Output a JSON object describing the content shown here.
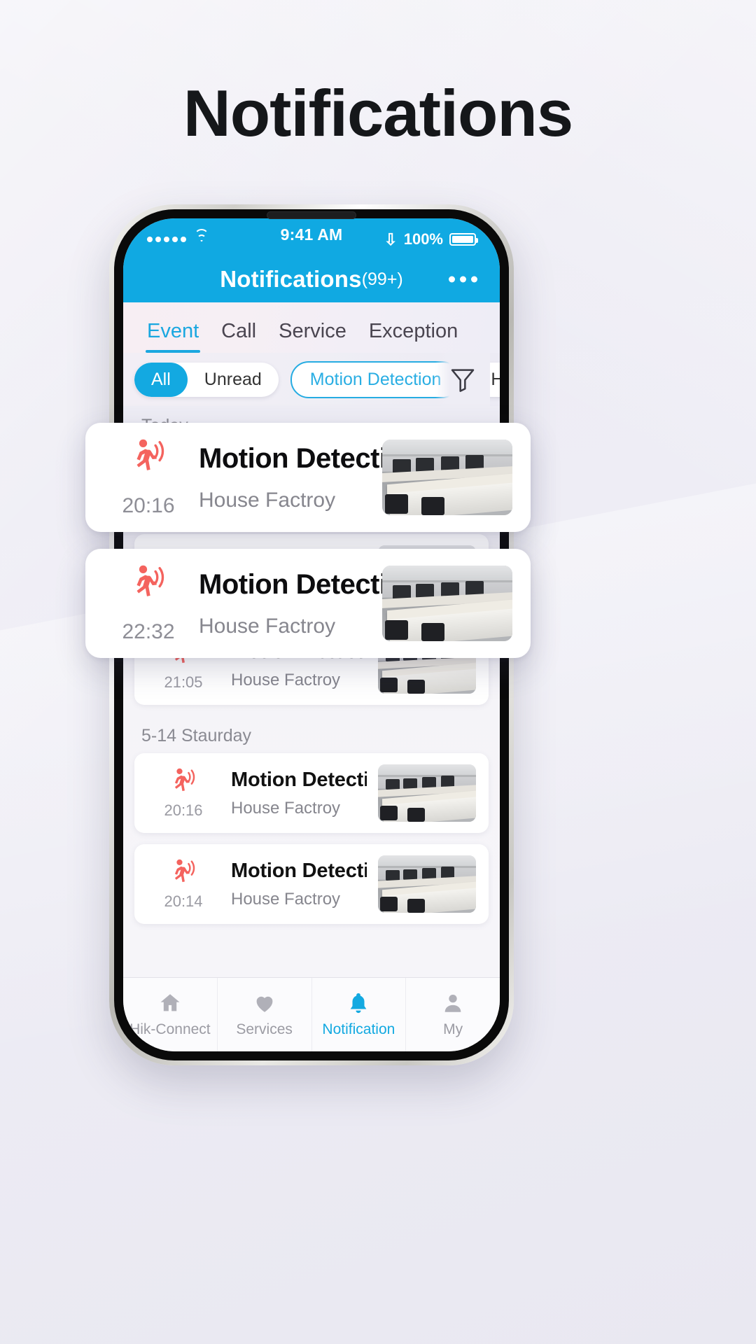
{
  "page": {
    "heading": "Notifications",
    "accent": "#13a9e1",
    "alert_red": "#f4635e",
    "bg": "#edecf4"
  },
  "status_bar": {
    "signal_icon": "signal-dots-icon",
    "wifi_icon": "wifi-icon",
    "time": "9:41 AM",
    "bluetooth_icon": "bluetooth-icon",
    "battery_percent": "100%",
    "battery_icon": "battery-full-icon"
  },
  "nav_bar": {
    "title": "Notifications",
    "count": "(99+)",
    "more_icon": "more-horizontal-icon"
  },
  "tabs": [
    {
      "label": "Event",
      "active": true
    },
    {
      "label": "Call",
      "active": false
    },
    {
      "label": "Service",
      "active": false
    },
    {
      "label": "Exception",
      "active": false
    }
  ],
  "filters": {
    "segmented": [
      {
        "label": "All",
        "selected": true
      },
      {
        "label": "Unread",
        "selected": false
      }
    ],
    "chips": [
      {
        "label": "Motion Detection",
        "selected": true
      },
      {
        "label": "Human Dete",
        "selected": false
      }
    ],
    "filter_icon": "funnel-filter-icon"
  },
  "sections": [
    {
      "label": "Today",
      "items": [
        {
          "time": "20:16",
          "title": "Motion Detection...",
          "device": "House Factroy",
          "unread": true,
          "icon": "motion-detection-icon",
          "thumbnail": "office-desks-thumbnail"
        },
        {
          "time": "22:32",
          "title": "Motion Detection...",
          "device": "House Factroy",
          "unread": false,
          "icon": "motion-detection-icon",
          "thumbnail": "office-desks-thumbnail"
        },
        {
          "time": "21:05",
          "title": "Motion Detection...",
          "device": "House Factroy",
          "unread": false,
          "icon": "motion-detection-icon",
          "thumbnail": "office-desks-thumbnail"
        }
      ]
    },
    {
      "label": "5-14 Staurday",
      "items": [
        {
          "time": "20:16",
          "title": "Motion Detection...",
          "device": "House Factroy",
          "unread": false,
          "icon": "motion-detection-icon",
          "thumbnail": "office-desks-thumbnail"
        },
        {
          "time": "20:14",
          "title": "Motion Detection...",
          "device": "House Factroy",
          "unread": false,
          "icon": "motion-detection-icon",
          "thumbnail": "office-desks-thumbnail"
        }
      ]
    }
  ],
  "callouts": [
    {
      "time": "20:16",
      "title": "Motion Detection...",
      "device": "House Factroy",
      "icon": "motion-detection-icon",
      "thumbnail": "office-desks-thumbnail"
    },
    {
      "time": "22:32",
      "title": "Motion Detection...",
      "device": "House Factroy",
      "icon": "motion-detection-icon",
      "thumbnail": "office-desks-thumbnail"
    }
  ],
  "tab_bar": [
    {
      "label": "Hik-Connect",
      "icon": "home-icon",
      "active": false
    },
    {
      "label": "Services",
      "icon": "heart-icon",
      "active": false
    },
    {
      "label": "Notification",
      "icon": "bell-icon",
      "active": true
    },
    {
      "label": "My",
      "icon": "person-icon",
      "active": false
    }
  ]
}
